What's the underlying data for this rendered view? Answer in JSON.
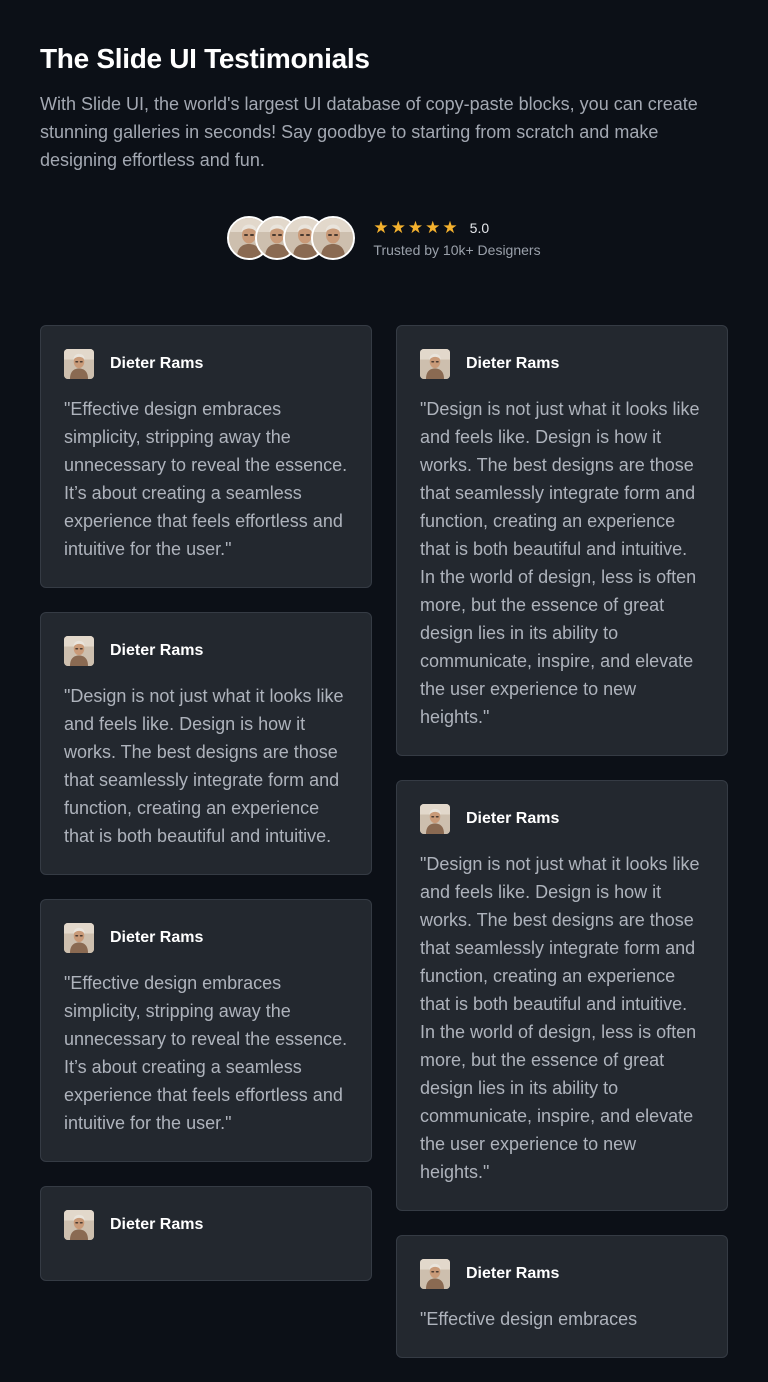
{
  "header": {
    "title": "The Slide UI Testimonials",
    "subtitle": "With Slide UI, the world's largest UI database of copy-paste blocks, you can create stunning galleries in seconds! Say goodbye to starting from scratch and make designing effortless and fun."
  },
  "rating": {
    "score": "5.0",
    "stars": 5,
    "star_glyph": "★",
    "trusted": "Trusted by 10k+ Designers",
    "star_color": "#f4b12e"
  },
  "columns": {
    "left": [
      {
        "name": "Dieter Rams",
        "quote": "\"Effective design embraces simplicity, stripping away the unnecessary to reveal the essence. It’s about creating a seamless experience that feels effortless and intuitive for the user.\""
      },
      {
        "name": "Dieter Rams",
        "quote": "\"Design is not just what it looks like and feels like. Design is how it works. The best designs are those that seamlessly integrate form and function, creating an experience that is both beautiful and intuitive."
      },
      {
        "name": "Dieter Rams",
        "quote": "\"Effective design embraces simplicity, stripping away the unnecessary to reveal the essence. It’s about creating a seamless experience that feels effortless and intuitive for the user.\""
      },
      {
        "name": "Dieter Rams",
        "quote": ""
      }
    ],
    "right": [
      {
        "name": "Dieter Rams",
        "quote": "\"Design is not just what it looks like and feels like. Design is how it works. The best designs are those that seamlessly integrate form and function, creating an experience that is both beautiful and intuitive. In the world of design, less is often more, but the essence of great design lies in its ability to communicate, inspire, and elevate the user experience to new heights.\""
      },
      {
        "name": "Dieter Rams",
        "quote": "\"Design is not just what it looks like and feels like. Design is how it works. The best designs are those that seamlessly integrate form and function, creating an experience that is both beautiful and intuitive. In the world of design, less is often more, but the essence of great design lies in its ability to communicate, inspire, and elevate the user experience to new heights.\""
      },
      {
        "name": "Dieter Rams",
        "quote": "\"Effective design embraces"
      }
    ]
  },
  "colors": {
    "background": "#0c1017",
    "card": "#23282f",
    "card_border": "#353b44"
  }
}
